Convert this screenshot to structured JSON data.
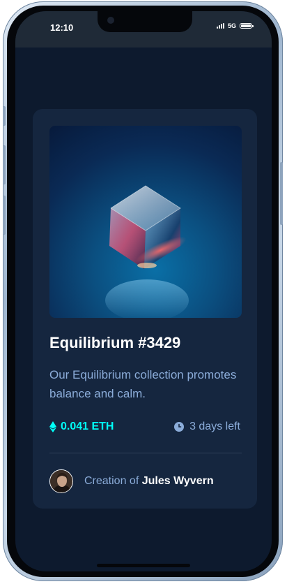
{
  "status_bar": {
    "time": "12:10",
    "network": "5G"
  },
  "card": {
    "image_alt_icon": "crystal-cube-image",
    "title": "Equilibrium #3429",
    "description": "Our Equilibrium collection promotes balance and calm.",
    "price": "0.041 ETH",
    "price_icon": "ethereum-icon",
    "time_left": "3 days left",
    "time_icon": "clock-icon",
    "creator_prefix": "Creation of",
    "creator_name": "Jules Wyvern"
  },
  "colors": {
    "background": "#0d1a2e",
    "card": "#15263f",
    "cyan": "#00fff8",
    "soft_blue": "#8bacd9",
    "divider": "#2e405a",
    "status_bar": "#1f2a37"
  }
}
